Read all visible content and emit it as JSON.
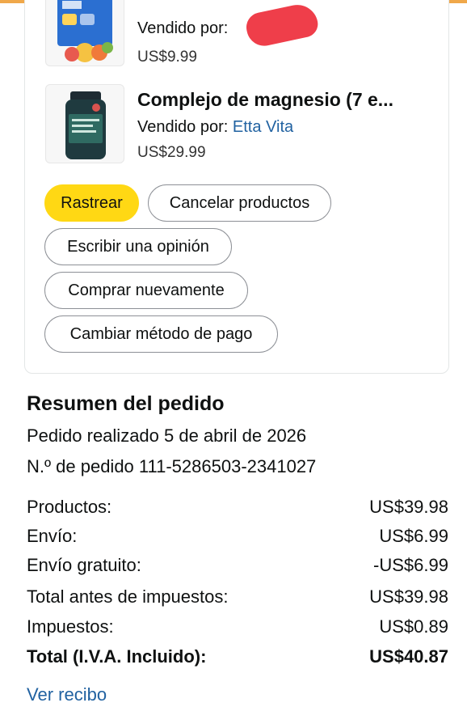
{
  "products": [
    {
      "title": "",
      "sold_by_prefix": "Vendido por:",
      "seller": "",
      "price": "US$9.99"
    },
    {
      "title": "Complejo de magnesio (7 e...",
      "sold_by_prefix": "Vendido por:",
      "seller": "Etta Vita",
      "price": "US$29.99"
    }
  ],
  "buttons": {
    "track": "Rastrear",
    "cancel": "Cancelar productos",
    "review": "Escribir una opinión",
    "buy_again": "Comprar nuevamente",
    "change_payment": "Cambiar método de pago"
  },
  "summary": {
    "title": "Resumen del pedido",
    "placed": "Pedido realizado 5 de abril de 2026",
    "order_number": "N.º de pedido 111-5286503-2341027",
    "rows": [
      {
        "label": "Productos:",
        "value": "US$39.98"
      },
      {
        "label": "Envío:",
        "value": "US$6.99"
      },
      {
        "label": "Envío gratuito:",
        "value": "-US$6.99"
      },
      {
        "label": "Total antes de impuestos:",
        "value": "US$39.98"
      },
      {
        "label": "Impuestos:",
        "value": "US$0.89"
      },
      {
        "label": "Total (I.V.A. Incluido):",
        "value": "US$40.87"
      }
    ],
    "receipt_link": "Ver recibo"
  },
  "colors": {
    "primary_button": "#ffd814",
    "link": "#2162a1",
    "redaction": "#ef3e4a"
  },
  "icons": {
    "product1": "supplement-box-image",
    "product2": "supplement-bottle-image"
  }
}
